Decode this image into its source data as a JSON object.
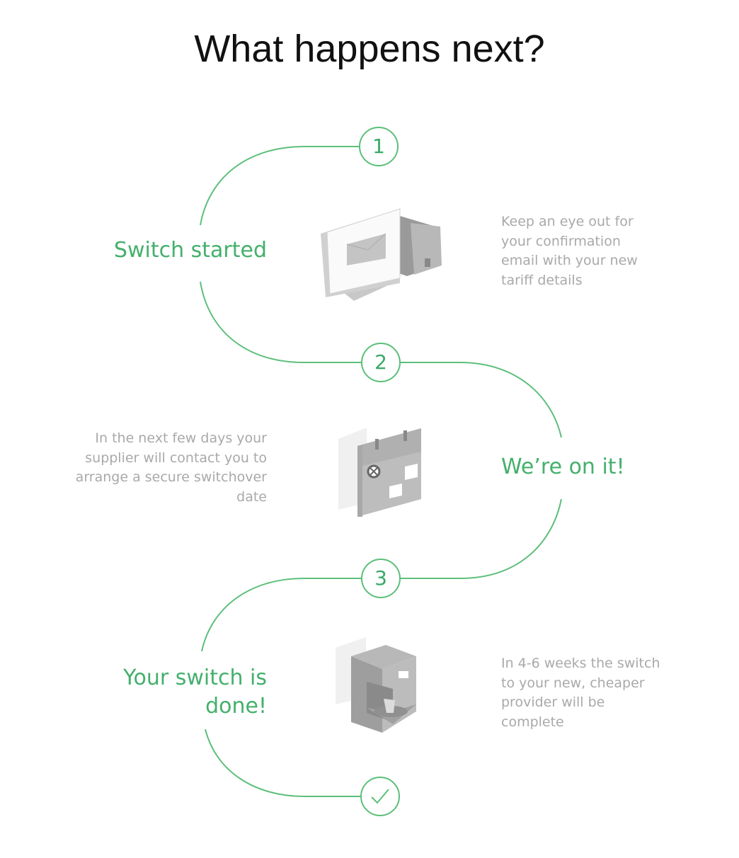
{
  "title": "What happens next?",
  "steps": [
    {
      "number": "1",
      "stage": "Switch started",
      "description": "Keep an eye out for your confirmation email with your new tariff details",
      "icon": "computer-email-icon"
    },
    {
      "number": "2",
      "stage": "We’re on it!",
      "description": "In the next few days your supplier will contact you to arrange a secure switchover date",
      "icon": "calendar-icon"
    },
    {
      "number": "3",
      "stage": "Your switch is done!",
      "description": "In 4-6 weeks the switch to your new, cheaper provider will be complete",
      "icon": "coffee-machine-icon"
    }
  ],
  "final_icon": "checkmark-icon",
  "colors": {
    "accent": "#5cbf7a",
    "accent_text": "#3aa868",
    "description": "#a9a9a9"
  }
}
